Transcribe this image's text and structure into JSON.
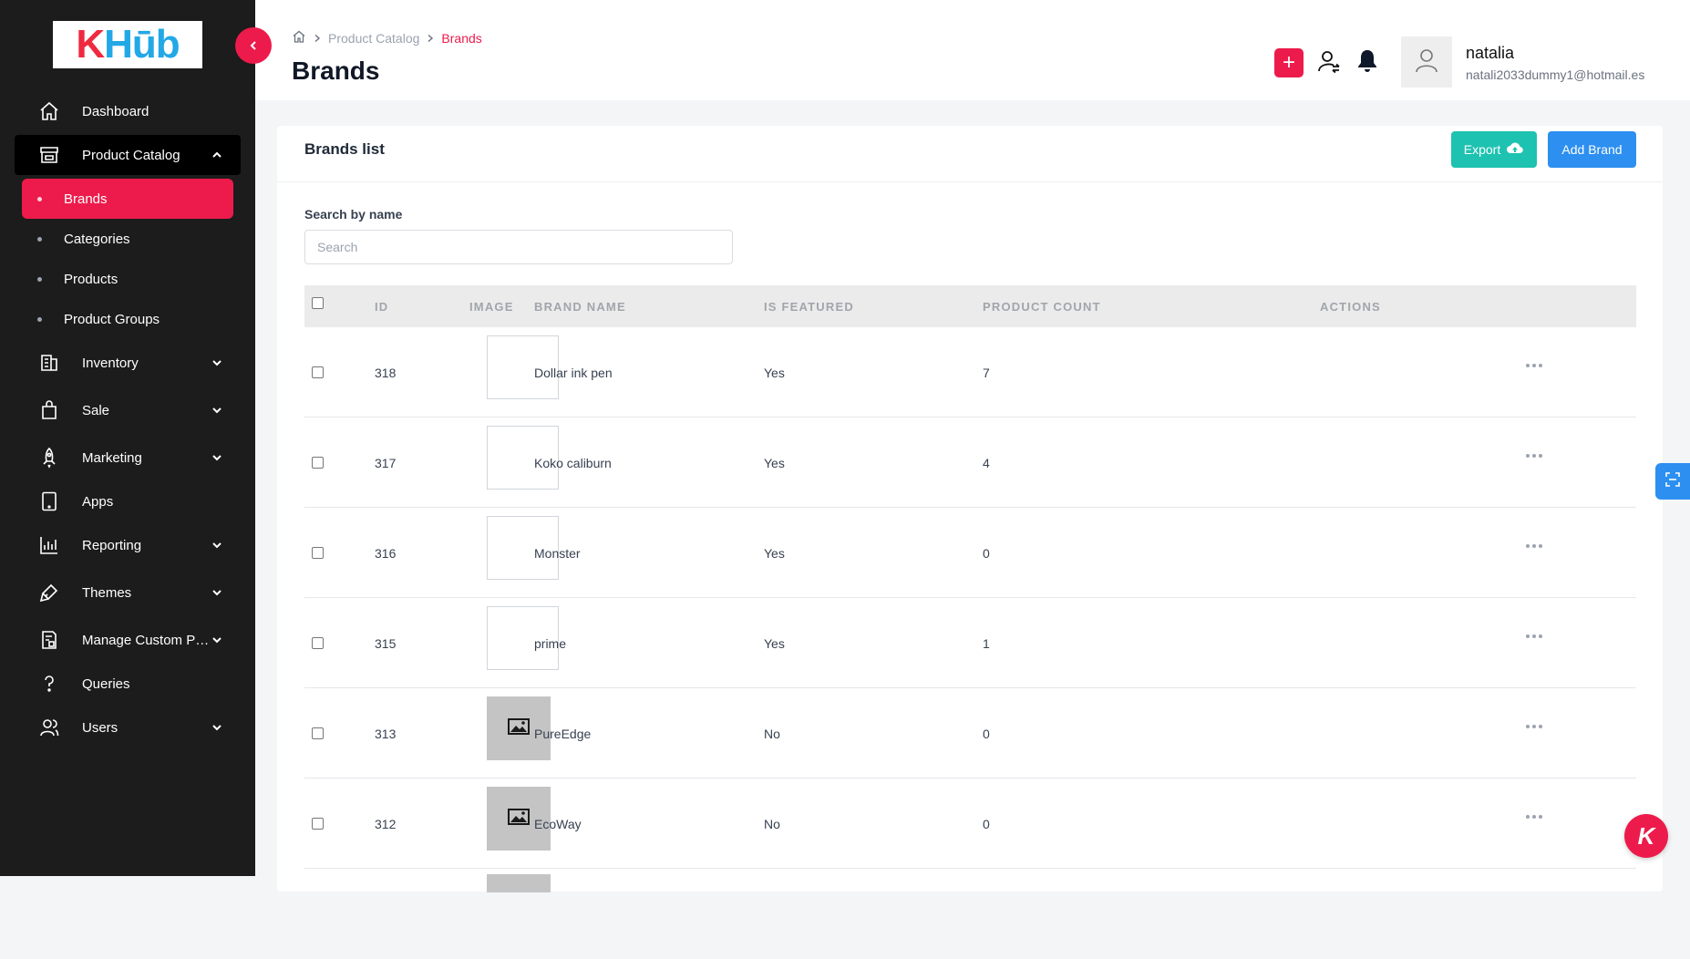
{
  "sidebar": {
    "logo": {
      "k": "K",
      "hub": "Hūb"
    },
    "items": [
      {
        "label": "Dashboard",
        "icon": "home-icon",
        "has_chevron": false
      },
      {
        "label": "Product Catalog",
        "icon": "store-icon",
        "has_chevron": true,
        "open": true
      },
      {
        "label": "Inventory",
        "icon": "inventory-icon",
        "has_chevron": true
      },
      {
        "label": "Sale",
        "icon": "shopping-bag-icon",
        "has_chevron": true
      },
      {
        "label": "Marketing",
        "icon": "rocket-icon",
        "has_chevron": true
      },
      {
        "label": "Apps",
        "icon": "tablet-icon",
        "has_chevron": false
      },
      {
        "label": "Reporting",
        "icon": "bar-chart-icon",
        "has_chevron": true
      },
      {
        "label": "Themes",
        "icon": "brush-icon",
        "has_chevron": true
      },
      {
        "label": "Manage Custom Pag...",
        "icon": "custom-page-icon",
        "has_chevron": true
      },
      {
        "label": "Queries",
        "icon": "question-icon",
        "has_chevron": false
      },
      {
        "label": "Users",
        "icon": "users-icon",
        "has_chevron": true
      }
    ],
    "sub_items": [
      {
        "label": "Brands",
        "active": true
      },
      {
        "label": "Categories",
        "active": false
      },
      {
        "label": "Products",
        "active": false
      },
      {
        "label": "Product Groups",
        "active": false
      }
    ]
  },
  "header": {
    "breadcrumb": [
      "Product Catalog",
      "Brands"
    ],
    "title": "Brands",
    "user": {
      "name": "natalia",
      "email": "natali2033dummy1@hotmail.es"
    }
  },
  "card": {
    "title": "Brands list",
    "export_label": "Export",
    "add_label": "Add Brand",
    "search_label": "Search by name",
    "search_placeholder": "Search"
  },
  "table": {
    "columns": [
      "ID",
      "IMAGE",
      "BRAND NAME",
      "IS FEATURED",
      "PRODUCT COUNT",
      "ACTIONS"
    ],
    "rows": [
      {
        "id": "318",
        "name": "Dollar ink pen",
        "featured": "Yes",
        "count": "7",
        "image": "blank"
      },
      {
        "id": "317",
        "name": "Koko caliburn",
        "featured": "Yes",
        "count": "4",
        "image": "blank"
      },
      {
        "id": "316",
        "name": "Monster",
        "featured": "Yes",
        "count": "0",
        "image": "blank"
      },
      {
        "id": "315",
        "name": "prime",
        "featured": "Yes",
        "count": "1",
        "image": "blank"
      },
      {
        "id": "313",
        "name": "PureEdge",
        "featured": "No",
        "count": "0",
        "image": "placeholder"
      },
      {
        "id": "312",
        "name": "EcoWay",
        "featured": "No",
        "count": "0",
        "image": "placeholder"
      }
    ]
  },
  "colors": {
    "accent": "#ec1b4b",
    "teal": "#1ec2b0",
    "blue": "#2d8ff0",
    "sidebar": "#1c1c1c"
  }
}
